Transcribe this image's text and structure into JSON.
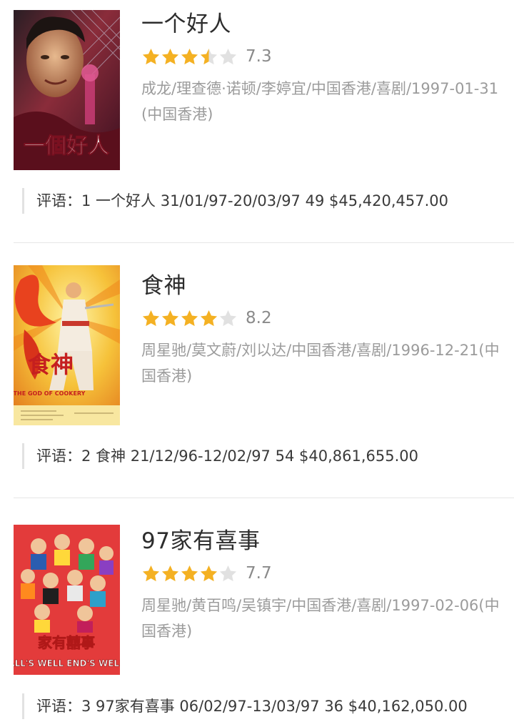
{
  "colors": {
    "star_filled": "#f4b123",
    "star_empty": "#e1e1e1",
    "meta_text": "#9b9b9b",
    "title_text": "#2d2d2d"
  },
  "review_prefix": "评语：",
  "movies": [
    {
      "title": "一个好人",
      "stars": 3.5,
      "score": "7.3",
      "meta": "成龙/理查德·诺顿/李婷宜/中国香港/喜剧/1997-01-31(中国香港)",
      "review": "1 一个好人 31/01/97-20/03/97 49 $45,420,457.00",
      "poster_text": "一個好人"
    },
    {
      "title": "食神",
      "stars": 4.0,
      "score": "8.2",
      "meta": "周星驰/莫文蔚/刘以达/中国香港/喜剧/1996-12-21(中国香港)",
      "review": "2 食神 21/12/96-12/02/97 54 $40,861,655.00",
      "poster_text": "食神",
      "poster_subtext": "THE GOD OF COOKERY"
    },
    {
      "title": "97家有喜事",
      "stars": 4.0,
      "score": "7.7",
      "meta": "周星驰/黄百鸣/吴镇宇/中国香港/喜剧/1997-02-06(中国香港)",
      "review": "3 97家有喜事 06/02/97-13/03/97 36 $40,162,050.00",
      "poster_text": "家有囍事",
      "poster_subtext": "ALL'S WELL END'S WELL"
    }
  ]
}
